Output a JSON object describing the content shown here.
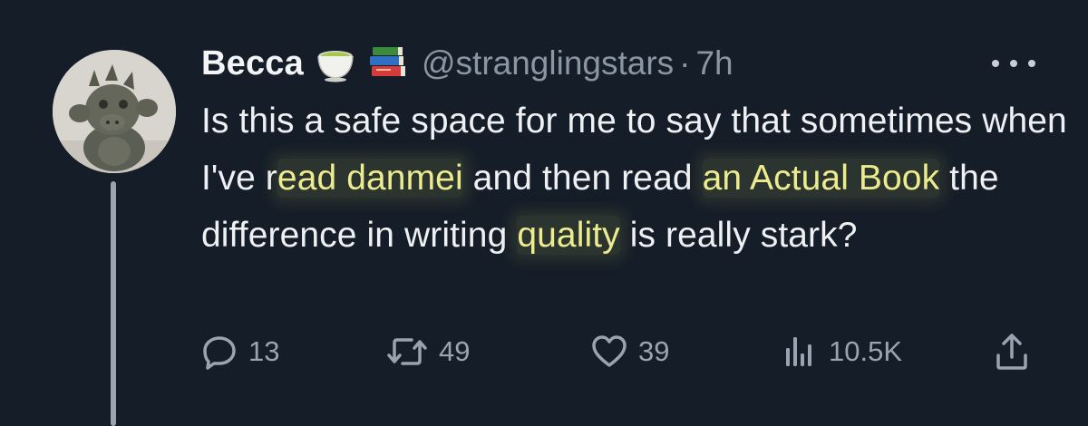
{
  "tweet": {
    "display_name": "Becca",
    "name_emojis": [
      "teacup-icon",
      "books-icon"
    ],
    "handle": "@stranglingstars",
    "separator": "·",
    "time": "7h",
    "text_segments": [
      {
        "text": "Is this a safe space for me to say that sometimes when I've r",
        "highlight": false
      },
      {
        "text": "ead danmei",
        "highlight": true
      },
      {
        "text": " and then read ",
        "highlight": false
      },
      {
        "text": "an Actual Book",
        "highlight": true
      },
      {
        "text": " the difference in writing ",
        "highlight": false
      },
      {
        "text": "quality",
        "highlight": true
      },
      {
        "text": " is really stark?",
        "highlight": false
      }
    ],
    "actions": {
      "reply_count": "13",
      "retweet_count": "49",
      "like_count": "39",
      "view_count": "10.5K"
    }
  },
  "colors": {
    "background": "#151d28",
    "text": "#eef0f3",
    "muted": "#8b96a3",
    "highlight_text": "#eceb8e"
  }
}
